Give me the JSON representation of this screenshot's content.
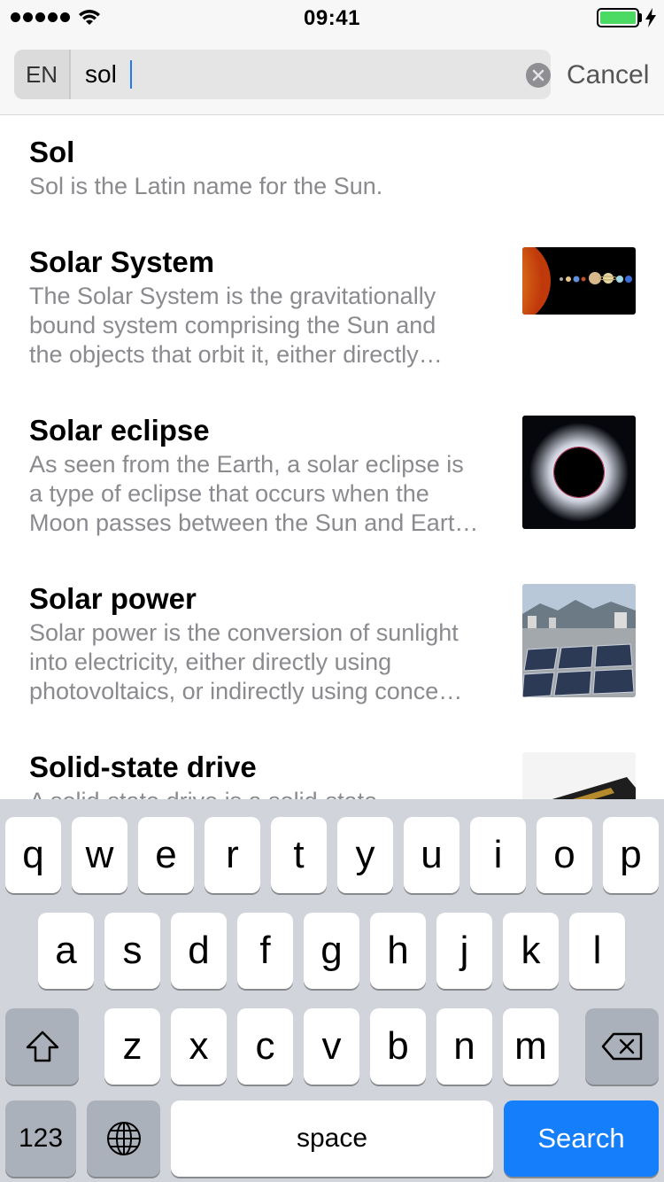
{
  "status_bar": {
    "time": "09:41",
    "battery_color": "#4cd964"
  },
  "search": {
    "language": "EN",
    "query": "sol",
    "cancel_label": "Cancel",
    "caret_color": "#1e7cf2"
  },
  "results": [
    {
      "title": "Sol",
      "lines": [
        "Sol is the Latin name for the Sun."
      ],
      "thumbnail": ""
    },
    {
      "title": "Solar System",
      "lines": [
        "The Solar System is the gravitationally",
        "bound system comprising the Sun and",
        "the objects that orbit it, either directly…"
      ],
      "thumbnail": "solar-system-image"
    },
    {
      "title": "Solar eclipse",
      "lines": [
        "As seen from the Earth, a solar eclipse is",
        "a type of eclipse that occurs when the",
        "Moon passes between the Sun and Eart…"
      ],
      "thumbnail": "solar-eclipse-image"
    },
    {
      "title": "Solar power",
      "lines": [
        "Solar power is the conversion of sunlight",
        "into electricity, either directly using",
        "photovoltaics, or indirectly using conce…"
      ],
      "thumbnail": "solar-panels-image"
    },
    {
      "title": "Solid-state drive",
      "lines": [
        "A solid-state drive is a solid-state"
      ],
      "thumbnail": "ssd-image"
    }
  ],
  "keyboard": {
    "row1": [
      "q",
      "w",
      "e",
      "r",
      "t",
      "y",
      "u",
      "i",
      "o",
      "p"
    ],
    "row2": [
      "a",
      "s",
      "d",
      "f",
      "g",
      "h",
      "j",
      "k",
      "l"
    ],
    "row3": [
      "z",
      "x",
      "c",
      "v",
      "b",
      "n",
      "m"
    ],
    "numbers_label": "123",
    "space_label": "space",
    "search_label": "Search",
    "accent_color": "#147efb"
  }
}
